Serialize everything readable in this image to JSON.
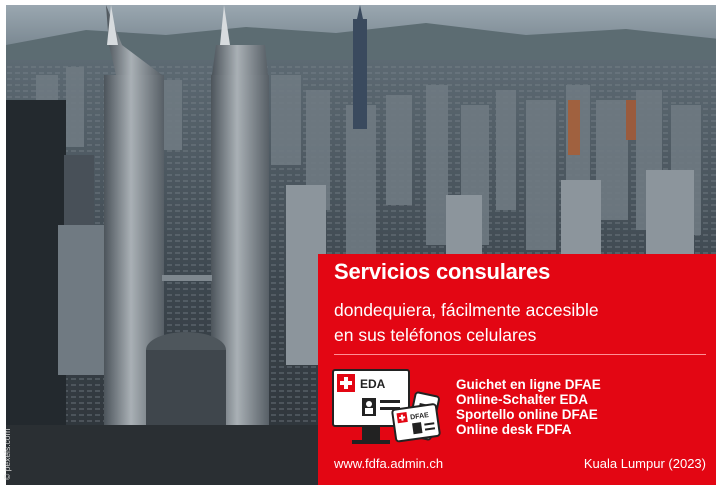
{
  "photo": {
    "subject": "aerial-city-skyline",
    "credit": "© pexels.com"
  },
  "panel": {
    "title": "Servicios consulares",
    "subtitle_line1": "dondequiera, fácilmente accesible",
    "subtitle_line2": "en sus teléfonos celulares",
    "device_label_monitor": "EDA",
    "device_label_phone": "DFAE",
    "online_desks": [
      "Guichet en ligne DFAE",
      "Online-Schalter EDA",
      "Sportello online DFAE",
      "Online desk FDFA"
    ],
    "website": "www.fdfa.admin.ch",
    "location": "Kuala Lumpur (2023)"
  },
  "colors": {
    "panel_red": "#e30613",
    "text_white": "#ffffff",
    "sky": "#8a9aa6",
    "city_shadow": "#2d3136"
  }
}
